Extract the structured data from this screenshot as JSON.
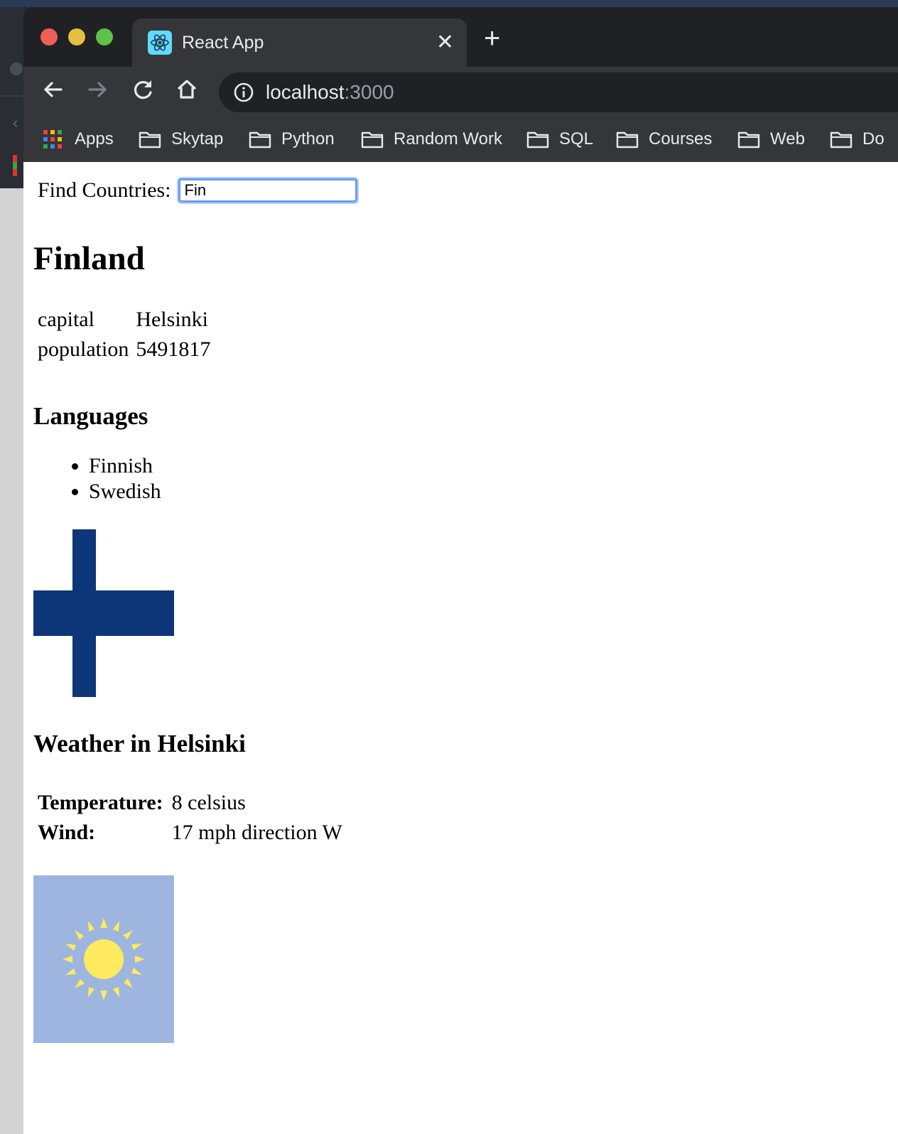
{
  "browser": {
    "tab_title": "React App",
    "url_host": "localhost",
    "url_port": ":3000",
    "bookmarks": [
      {
        "label": "Apps"
      },
      {
        "label": "Skytap"
      },
      {
        "label": "Python"
      },
      {
        "label": "Random Work"
      },
      {
        "label": "SQL"
      },
      {
        "label": "Courses"
      },
      {
        "label": "Web"
      },
      {
        "label": "Do"
      }
    ]
  },
  "search": {
    "label": "Find Countries:",
    "value": "Fin"
  },
  "country": {
    "name": "Finland",
    "facts": [
      {
        "key": "capital",
        "value": "Helsinki"
      },
      {
        "key": "population",
        "value": "5491817"
      }
    ],
    "languages_heading": "Languages",
    "languages": [
      "Finnish",
      "Swedish"
    ],
    "flag_colors": {
      "field": "#ffffff",
      "cross": "#0d3679"
    }
  },
  "weather": {
    "heading": "Weather in Helsinki",
    "rows": [
      {
        "key": "Temperature:",
        "value": "8 celsius"
      },
      {
        "key": "Wind:",
        "value": "17 mph direction W"
      }
    ],
    "icon": "sunny-icon",
    "icon_colors": {
      "background": "#9db5df",
      "sun": "#fdea5e"
    }
  }
}
